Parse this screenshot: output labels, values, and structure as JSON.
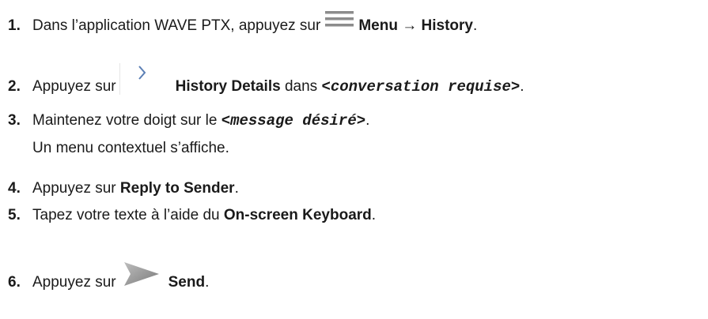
{
  "steps": [
    {
      "number": "1.",
      "before": "Dans l’application WAVE PTX, appuyez sur",
      "icon": "hamburger-menu-icon",
      "bold1": "Menu",
      "arrow": " → ",
      "bold2": "History",
      "after": "."
    },
    {
      "number": "2.",
      "before": "Appuyez sur",
      "icon": "chevron-right-icon",
      "bold": "History Details",
      "middle": " dans ",
      "mono": "<conversation requise>",
      "after": "."
    },
    {
      "number": "3.",
      "before": "Maintenez votre doigt sur le ",
      "mono": "<message désiré>",
      "after": ".",
      "result": "Un menu contextuel s’affiche."
    },
    {
      "number": "4.",
      "before": "Appuyez sur ",
      "bold": "Reply to Sender",
      "after": "."
    },
    {
      "number": "5.",
      "before": "Tapez votre texte à l’aide du ",
      "bold": "On-screen Keyboard",
      "after": "."
    },
    {
      "number": "6.",
      "before": "Appuyez sur",
      "icon": "send-arrow-icon",
      "bold": "Send",
      "after": "."
    }
  ],
  "colors": {
    "text": "#1a1a1a",
    "icon_gray": "#8c8c8c",
    "chevron_blue": "#5b7fb5"
  }
}
